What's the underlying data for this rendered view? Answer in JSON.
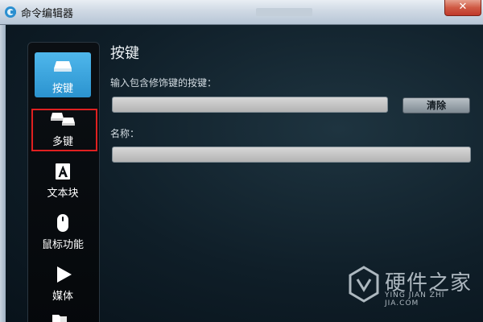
{
  "window": {
    "title": "命令编辑器",
    "close_label": "✕"
  },
  "sidebar": {
    "items": [
      {
        "label": "按键",
        "icon": "key-icon",
        "active": true
      },
      {
        "label": "多键",
        "icon": "multi-key-icon",
        "active": false
      },
      {
        "label": "文本块",
        "icon": "text-block-icon",
        "active": false
      },
      {
        "label": "鼠标功能",
        "icon": "mouse-icon",
        "active": false
      },
      {
        "label": "媒体",
        "icon": "play-icon",
        "active": false
      }
    ]
  },
  "main": {
    "title": "按键",
    "keystroke_label": "输入包含修饰键的按键：",
    "keystroke_value": "",
    "clear_button": "清除",
    "name_label": "名称：",
    "name_value": ""
  },
  "watermark": {
    "text_cn": "硬件之家",
    "text_en": "YING JIAN ZHI JIA.COM"
  },
  "colors": {
    "active_item": "#3aa6e0",
    "highlight_box": "#e02020"
  }
}
